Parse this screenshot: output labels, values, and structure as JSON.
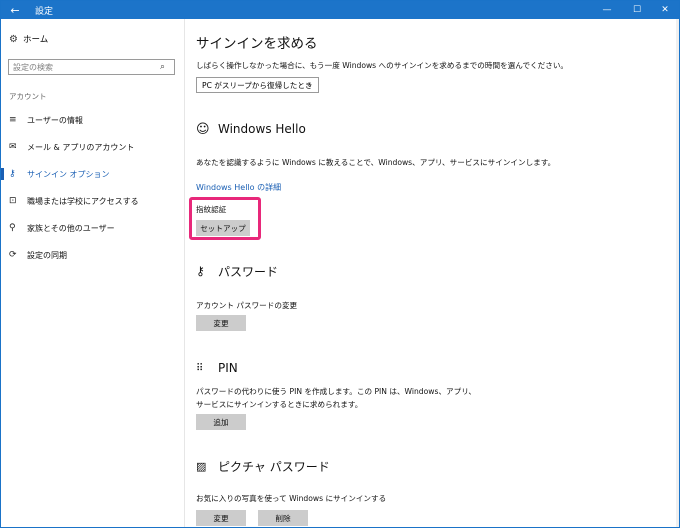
{
  "window": {
    "title": "設定",
    "back_icon": "←",
    "min_icon": "—",
    "max_icon": "☐",
    "close_icon": "✕"
  },
  "sidebar": {
    "home": {
      "label": "ホーム",
      "icon": "gear-icon"
    },
    "search_placeholder": "設定の検索",
    "section_label": "アカウント",
    "items": [
      {
        "label": "ユーザーの情報",
        "icon": "user-info-icon",
        "active": false
      },
      {
        "label": "メール & アプリのアカウント",
        "icon": "mail-icon",
        "active": false
      },
      {
        "label": "サインイン オプション",
        "icon": "key-icon",
        "active": true
      },
      {
        "label": "職場または学校にアクセスする",
        "icon": "briefcase-icon",
        "active": false
      },
      {
        "label": "家族とその他のユーザー",
        "icon": "person-add-icon",
        "active": false
      },
      {
        "label": "設定の同期",
        "icon": "sync-icon",
        "active": false
      }
    ]
  },
  "main": {
    "require_signin": {
      "title": "サインインを求める",
      "description": "しばらく操作しなかった場合に、もう一度 Windows へのサインインを求めるまでの時間を選んでください。",
      "dropdown_value": "PC がスリープから復帰したとき"
    },
    "hello": {
      "title": "Windows Hello",
      "description": "あなたを認識するように Windows に教えることで、Windows、アプリ、サービスにサインインします。",
      "link": "Windows Hello の詳細",
      "fingerprint_label": "指紋認証",
      "setup_button": "セットアップ"
    },
    "password": {
      "title": "パスワード",
      "description": "アカウント パスワードの変更",
      "change_button": "変更"
    },
    "pin": {
      "title": "PIN",
      "description_1": "パスワードの代わりに使う PIN を作成します。この PIN は、Windows、アプリ、",
      "description_2": "サービスにサインインするときに求められます。",
      "add_button": "追加"
    },
    "picture_password": {
      "title": "ピクチャ パスワード",
      "description": "お気に入りの写真を使って Windows にサインインする",
      "change_button": "変更",
      "remove_button": "削除"
    }
  },
  "colors": {
    "titlebar": "#1c74c9",
    "accent": "#1a5fb4",
    "highlight": "#e8287a",
    "button": "#cccccc"
  }
}
